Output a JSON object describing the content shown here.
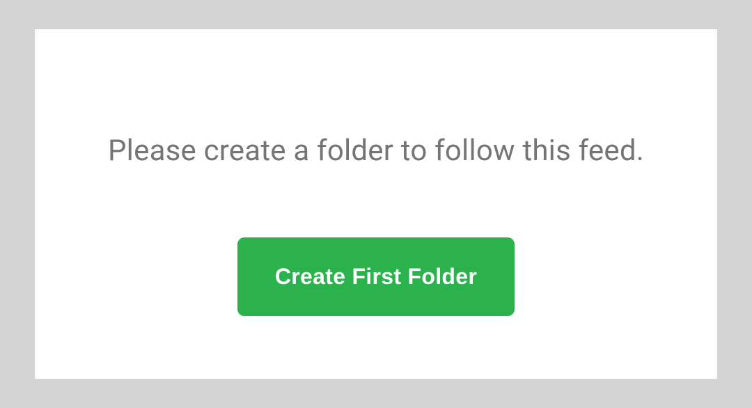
{
  "dialog": {
    "prompt_text": "Please create a folder to follow this feed.",
    "create_button_label": "Create First Folder"
  }
}
